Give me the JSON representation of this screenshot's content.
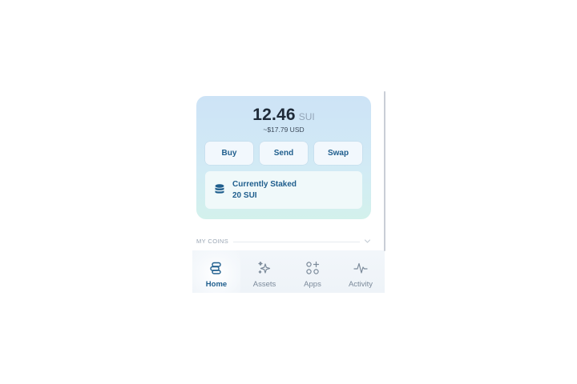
{
  "balance": {
    "amount": "12.46",
    "unit": "SUI",
    "usd": "~$17.79 USD"
  },
  "actions": {
    "buy_label": "Buy",
    "send_label": "Send",
    "swap_label": "Swap"
  },
  "staked": {
    "title": "Currently Staked",
    "amount": "20 SUI",
    "icon": "coin-stack-icon"
  },
  "coins": {
    "section_label": "MY COINS",
    "icon": "chevron-down-icon"
  },
  "nav": {
    "items": [
      {
        "label": "Home",
        "icon": "coins-icon",
        "active": true
      },
      {
        "label": "Assets",
        "icon": "sparkles-icon",
        "active": false
      },
      {
        "label": "Apps",
        "icon": "apps-grid-icon",
        "active": false
      },
      {
        "label": "Activity",
        "icon": "activity-pulse-icon",
        "active": false
      }
    ]
  },
  "colors": {
    "accent": "#1f5e8d",
    "card_gradient_top": "#cde3f6",
    "card_gradient_bottom": "#d3f1ec",
    "muted_text": "#7b8a9a"
  }
}
